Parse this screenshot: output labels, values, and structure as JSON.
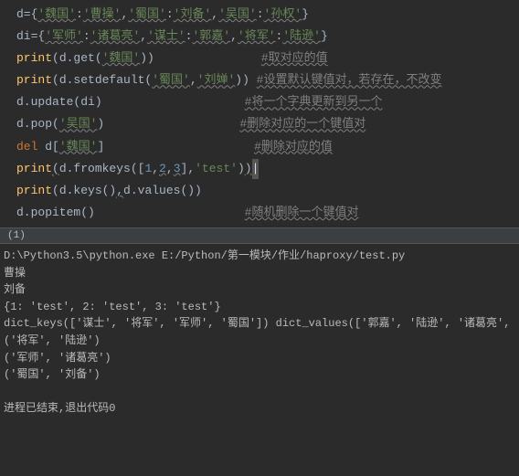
{
  "code": {
    "l0_a": "d={",
    "l0_s1": "'魏国'",
    "l0_c1": ":",
    "l0_s2": "'曹操'",
    "l0_c2": ",",
    "l0_s3": "'蜀国'",
    "l0_c3": ":",
    "l0_s4": "'刘备'",
    "l0_c4": ",",
    "l0_s5": "'吴国'",
    "l0_c5": ":",
    "l0_s6": "'孙权'",
    "l0_e": "}",
    "l1_a": "di={",
    "l1_s1": "'军师'",
    "l1_c1": ":",
    "l1_s2": "'诸葛亮'",
    "l1_c2": ",",
    "l1_s3": "'谋士'",
    "l1_c3": ":",
    "l1_s4": "'郭嘉'",
    "l1_c4": ",",
    "l1_s5": "'将军'",
    "l1_c5": ":",
    "l1_s6": "'陆逊'",
    "l1_e": "}",
    "l2_p": "print",
    "l2_a": "(d.get(",
    "l2_s": "'魏国'",
    "l2_e": "))",
    "l2_sp": "               ",
    "l2_c": "#取对应的值",
    "l3_p": "print",
    "l3_a": "(d.setdefault(",
    "l3_s1": "'蜀国'",
    "l3_c1": ",",
    "l3_s2": "'刘婵'",
    "l3_e": ")) ",
    "l3_c": "#设置默认键值对，若存在，不改变",
    "l4_a": "d.update(di)",
    "l4_sp": "                    ",
    "l4_c": "#将一个字典更新到另一个",
    "l5_a": "d.pop(",
    "l5_s": "'吴国'",
    "l5_e": ")",
    "l5_sp": "                   ",
    "l5_c": "#删除对应的一个键值对",
    "l6_k": "del ",
    "l6_a": "d[",
    "l6_s": "'魏国'",
    "l6_e": "]",
    "l6_sp": "                     ",
    "l6_c": "#删除对应的值",
    "l7_p": "print",
    "l7_a1": "(",
    "l7_a": "d.fromkeys([",
    "l7_n1": "1",
    "l7_c1": ",",
    "l7_n2": "2",
    "l7_c2": ",",
    "l7_n3": "3",
    "l7_a2": "],",
    "l7_s": "'test'",
    "l7_e": ")",
    "l7_e2": ")",
    "l8_p": "print",
    "l8_a": "(d.keys()",
    "l8_c1": ",",
    "l8_b": "d.values())",
    "l9_a": "d.popitem()",
    "l9_sp": "                     ",
    "l9_c": "#随机删除一个键值对"
  },
  "tab": "(1)",
  "console": {
    "c0": "D:\\Python3.5\\python.exe E:/Python/第一模块/作业/haproxy/test.py",
    "c1": "曹操",
    "c2": "刘备",
    "c3": "{1: 'test', 2: 'test', 3: 'test'}",
    "c4": "dict_keys(['谋士', '将军', '军师', '蜀国']) dict_values(['郭嘉', '陆逊', '诸葛亮', '刘备'])",
    "c5": "('将军', '陆逊')",
    "c6": "('军师', '诸葛亮')",
    "c7": "('蜀国', '刘备')",
    "c8": " ",
    "c9": "进程已结束,退出代码0"
  }
}
